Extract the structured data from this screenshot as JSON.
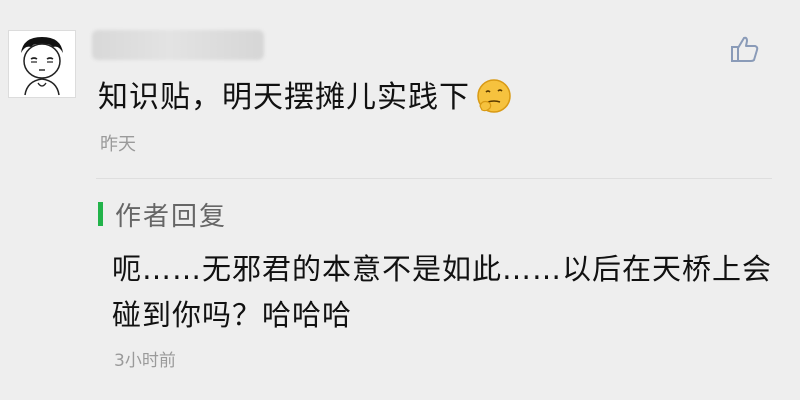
{
  "comment": {
    "text": "知识贴，明天摆摊儿实践下",
    "emoji_icon": "thinking-face-emoji",
    "timestamp": "昨天",
    "like_icon": "thumbs-up-icon"
  },
  "reply": {
    "label": "作者回复",
    "text": "呃……无邪君的本意不是如此……以后在天桥上会碰到你吗？哈哈哈",
    "timestamp": "3小时前",
    "accent_color": "#22b34a"
  }
}
